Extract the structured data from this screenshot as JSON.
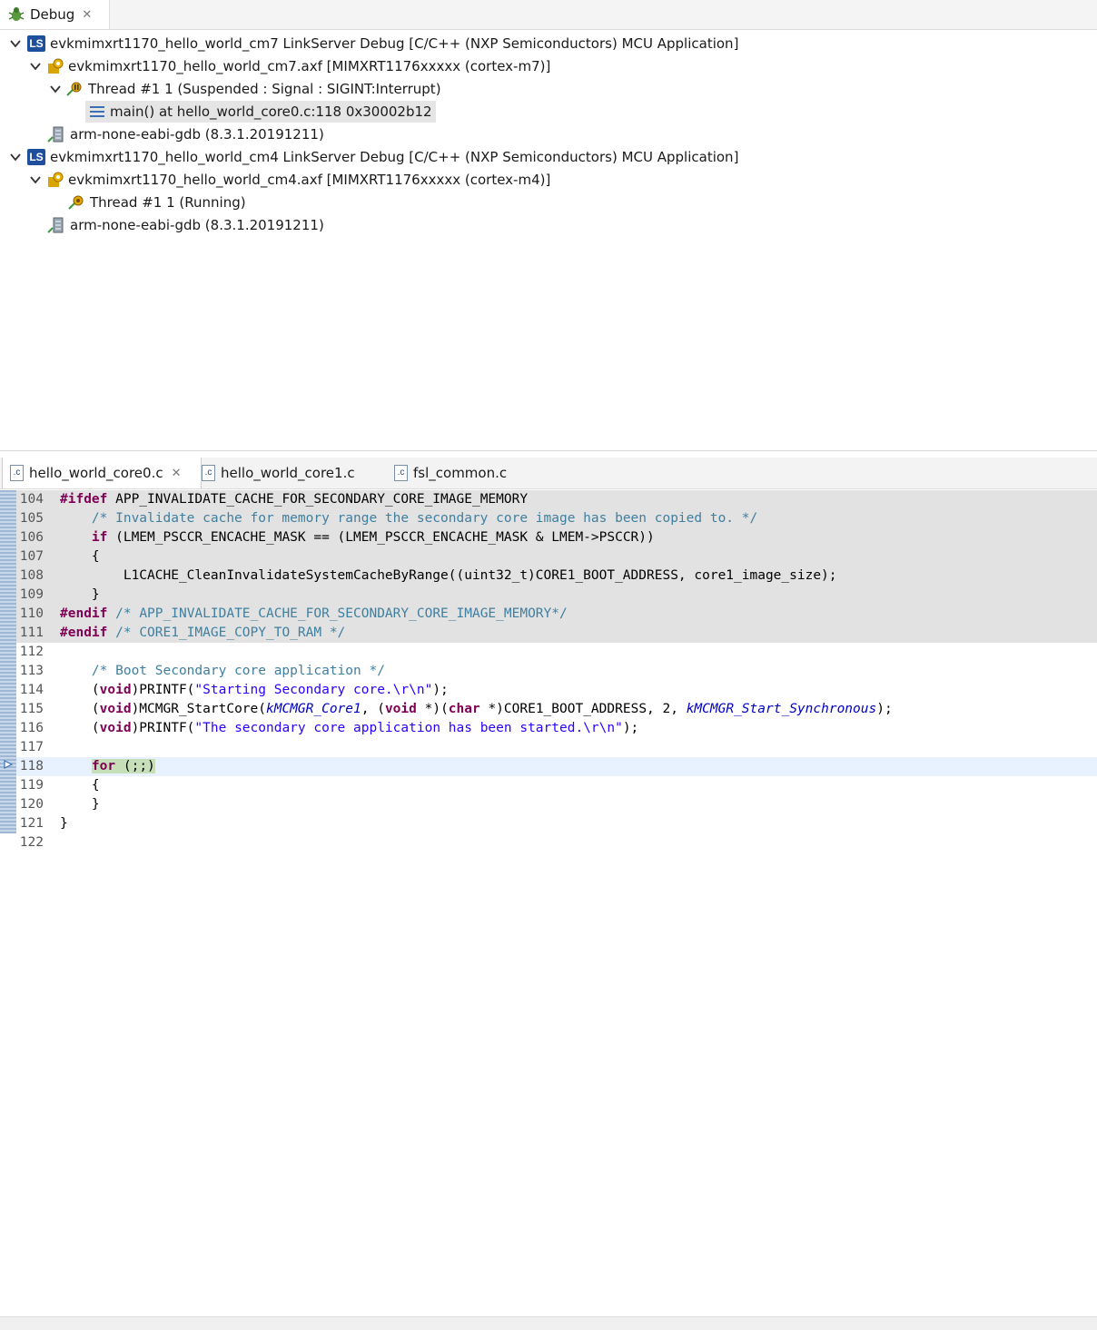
{
  "debug": {
    "tab_label": "Debug",
    "rows": [
      {
        "label": "evkmimxrt1170_hello_world_cm7 LinkServer Debug [C/C++ (NXP Semiconductors) MCU Application]"
      },
      {
        "label": "evkmimxrt1170_hello_world_cm7.axf [MIMXRT1176xxxxx (cortex-m7)]"
      },
      {
        "label": "Thread #1 1 (Suspended : Signal : SIGINT:Interrupt)"
      },
      {
        "label": "main() at hello_world_core0.c:118 0x30002b12"
      },
      {
        "label": "arm-none-eabi-gdb (8.3.1.20191211)"
      },
      {
        "label": "evkmimxrt1170_hello_world_cm4 LinkServer Debug [C/C++ (NXP Semiconductors) MCU Application]"
      },
      {
        "label": "evkmimxrt1170_hello_world_cm4.axf [MIMXRT1176xxxxx (cortex-m4)]"
      },
      {
        "label": "Thread #1 1 (Running)"
      },
      {
        "label": "arm-none-eabi-gdb (8.3.1.20191211)"
      }
    ],
    "ls_icon_text": "LS"
  },
  "editor": {
    "tabs": [
      {
        "label": "hello_world_core0.c"
      },
      {
        "label": "hello_world_core1.c"
      },
      {
        "label": "fsl_common.c"
      }
    ],
    "c_icon_text": ".c",
    "lines": [
      {
        "num": "104",
        "parts": [
          {
            "c": "kw",
            "t": "#ifdef"
          },
          {
            "c": "",
            "t": " APP_INVALIDATE_CACHE_FOR_SECONDARY_CORE_IMAGE_MEMORY"
          }
        ]
      },
      {
        "num": "105",
        "parts": [
          {
            "c": "",
            "t": "    "
          },
          {
            "c": "cm",
            "t": "/* Invalidate cache for memory range the secondary core image has been copied to. */"
          }
        ]
      },
      {
        "num": "106",
        "parts": [
          {
            "c": "",
            "t": "    "
          },
          {
            "c": "kw",
            "t": "if"
          },
          {
            "c": "",
            "t": " (LMEM_PSCCR_ENCACHE_MASK == (LMEM_PSCCR_ENCACHE_MASK & LMEM->PSCCR))"
          }
        ]
      },
      {
        "num": "107",
        "parts": [
          {
            "c": "",
            "t": "    {"
          }
        ]
      },
      {
        "num": "108",
        "parts": [
          {
            "c": "",
            "t": "        L1CACHE_CleanInvalidateSystemCacheByRange((uint32_t)CORE1_BOOT_ADDRESS, core1_image_size);"
          }
        ]
      },
      {
        "num": "109",
        "parts": [
          {
            "c": "",
            "t": "    }"
          }
        ]
      },
      {
        "num": "110",
        "parts": [
          {
            "c": "kw",
            "t": "#endif"
          },
          {
            "c": "",
            "t": " "
          },
          {
            "c": "cm",
            "t": "/* APP_INVALIDATE_CACHE_FOR_SECONDARY_CORE_IMAGE_MEMORY*/"
          }
        ]
      },
      {
        "num": "111",
        "parts": [
          {
            "c": "kw",
            "t": "#endif"
          },
          {
            "c": "",
            "t": " "
          },
          {
            "c": "cm",
            "t": "/* CORE1_IMAGE_COPY_TO_RAM */"
          }
        ]
      },
      {
        "num": "112",
        "parts": []
      },
      {
        "num": "113",
        "parts": [
          {
            "c": "",
            "t": "    "
          },
          {
            "c": "cm",
            "t": "/* Boot Secondary core application */"
          }
        ]
      },
      {
        "num": "114",
        "parts": [
          {
            "c": "",
            "t": "    ("
          },
          {
            "c": "kw",
            "t": "void"
          },
          {
            "c": "",
            "t": ")PRINTF("
          },
          {
            "c": "str",
            "t": "\"Starting Secondary core.\\r\\n\""
          },
          {
            "c": "",
            "t": ");"
          }
        ]
      },
      {
        "num": "115",
        "parts": [
          {
            "c": "",
            "t": "    ("
          },
          {
            "c": "kw",
            "t": "void"
          },
          {
            "c": "",
            "t": ")MCMGR_StartCore("
          },
          {
            "c": "ital",
            "t": "kMCMGR_Core1"
          },
          {
            "c": "",
            "t": ", ("
          },
          {
            "c": "kw",
            "t": "void"
          },
          {
            "c": "",
            "t": " *)("
          },
          {
            "c": "kw",
            "t": "char"
          },
          {
            "c": "",
            "t": " *)CORE1_BOOT_ADDRESS, 2, "
          },
          {
            "c": "ital",
            "t": "kMCMGR_Start_Synchronous"
          },
          {
            "c": "",
            "t": ");"
          }
        ]
      },
      {
        "num": "116",
        "parts": [
          {
            "c": "",
            "t": "    ("
          },
          {
            "c": "kw",
            "t": "void"
          },
          {
            "c": "",
            "t": ")PRINTF("
          },
          {
            "c": "str",
            "t": "\"The secondary core application has been started.\\r\\n\""
          },
          {
            "c": "",
            "t": ");"
          }
        ]
      },
      {
        "num": "117",
        "parts": []
      },
      {
        "num": "118",
        "parts": [
          {
            "c": "",
            "t": "    "
          },
          {
            "c": "kw curhl",
            "t": "for"
          },
          {
            "c": "curhl",
            "t": " (;;)"
          }
        ]
      },
      {
        "num": "119",
        "parts": [
          {
            "c": "",
            "t": "    {"
          }
        ]
      },
      {
        "num": "120",
        "parts": [
          {
            "c": "",
            "t": "    }"
          }
        ]
      },
      {
        "num": "121",
        "parts": [
          {
            "c": "",
            "t": "}"
          }
        ]
      },
      {
        "num": "122",
        "parts": []
      }
    ]
  },
  "colors": {
    "inactive_bg": "#e2e2e2",
    "current_line_bg": "#e8f2fe",
    "keyword": "#7f0055",
    "comment": "#3f7f9f",
    "string": "#2a00ff"
  }
}
